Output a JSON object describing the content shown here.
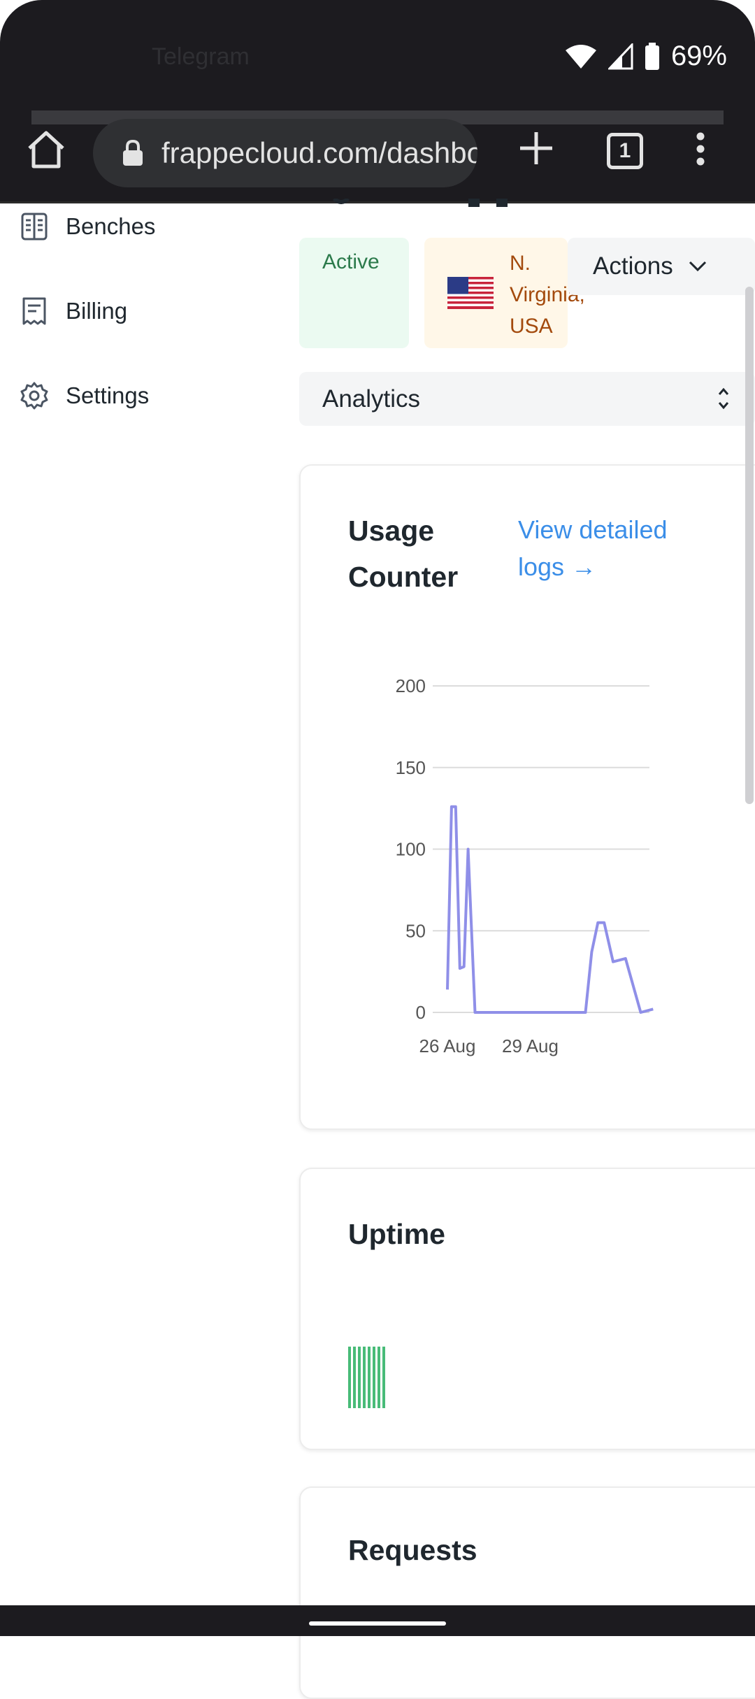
{
  "status_bar": {
    "bg_app_label": "Telegram",
    "battery": "69%"
  },
  "browser": {
    "url": "frappecloud.com/dashboard",
    "tab_count": "1"
  },
  "sidebar": {
    "items": [
      {
        "label": "Benches",
        "icon": "benches-icon"
      },
      {
        "label": "Billing",
        "icon": "receipt-icon"
      },
      {
        "label": "Settings",
        "icon": "gear-icon"
      }
    ]
  },
  "site": {
    "status": "Active",
    "region": "N. Virginia, USA",
    "actions_label": "Actions",
    "tab_select_value": "Analytics"
  },
  "usage_card": {
    "title": "Usage Counter",
    "link": "View detailed logs →"
  },
  "uptime_card": {
    "title": "Uptime",
    "bars": 8,
    "bar_color": "#48bb78"
  },
  "requests_card": {
    "title": "Requests"
  },
  "colors": {
    "accent": "#3b8ee8",
    "line": "#8f8fe8",
    "active_bg": "#ebfaf1",
    "region_bg": "#fff7e8"
  },
  "chart_data": {
    "type": "line",
    "title": "Usage Counter",
    "xlabel": "",
    "ylabel": "",
    "ylim": [
      0,
      200
    ],
    "yticks": [
      0,
      50,
      100,
      150,
      200
    ],
    "xticks": [
      "26 Aug",
      "29 Aug"
    ],
    "grid": true,
    "series": [
      {
        "values": [
          {
            "x": "26 Aug",
            "y": 14
          },
          {
            "x": "26 Aug",
            "y": 126
          },
          {
            "x": "26 Aug",
            "y": 126
          },
          {
            "x": "26 Aug",
            "y": 27
          },
          {
            "x": "26 Aug",
            "y": 28
          },
          {
            "x": "26 Aug",
            "y": 100
          },
          {
            "x": "27 Aug",
            "y": 0
          },
          {
            "x": "31 Aug",
            "y": 0
          },
          {
            "x": "31 Aug",
            "y": 37
          },
          {
            "x": "31 Aug",
            "y": 55
          },
          {
            "x": "31 Aug",
            "y": 55
          },
          {
            "x": "1 Sep",
            "y": 31
          },
          {
            "x": "1 Sep",
            "y": 33
          },
          {
            "x": "2 Sep",
            "y": 0
          },
          {
            "x": "2 Sep",
            "y": 2
          }
        ]
      }
    ]
  }
}
